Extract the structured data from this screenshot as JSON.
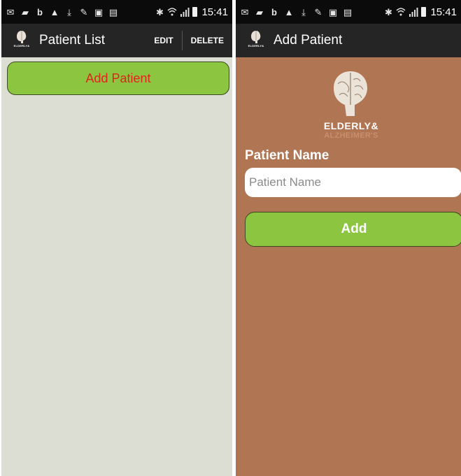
{
  "status_bar": {
    "time": "15:41",
    "notification_icons": [
      "mail-icon",
      "video-icon",
      "b-icon",
      "warning-icon",
      "download-icon",
      "pen-icon",
      "photo-icon",
      "gallery-icon"
    ],
    "system_icons": [
      "bluetooth-icon",
      "wifi-icon",
      "signal-icon",
      "battery-icon"
    ]
  },
  "list_screen": {
    "title": "Patient List",
    "actions": {
      "edit": "EDIT",
      "delete": "DELETE"
    },
    "add_patient_label": "Add Patient",
    "background_color": "#dcddd3",
    "button_color": "#8cc53f",
    "button_text_color": "#e0241c"
  },
  "add_screen": {
    "title": "Add Patient",
    "brand": {
      "line1": "ELDERLY",
      "amp": "&",
      "line2": "ALZHEIMER'S"
    },
    "field_label": "Patient Name",
    "field_placeholder": "Patient Name",
    "field_value": "",
    "add_button_label": "Add",
    "background_color": "#b07552"
  },
  "app_logo_text": "ELDERLY&"
}
